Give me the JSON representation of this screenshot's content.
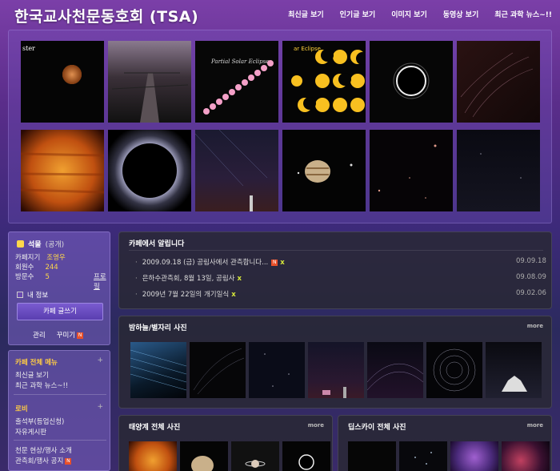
{
  "header": {
    "site_title": "한국교사천문동호회 (TSA)",
    "nav": [
      "최신글 보기",
      "인기글 보기",
      "이미지 보기",
      "동영상 보기",
      "최근 과학 뉴스~!!"
    ]
  },
  "gallery": {
    "thumbs": [
      {
        "icon": "jupiter-photo",
        "caption": "ster"
      },
      {
        "icon": "boardwalk-photo",
        "caption": ""
      },
      {
        "icon": "partial-eclipse-sequence-photo",
        "caption": "Partial Solar Eclipse"
      },
      {
        "icon": "eclipse-phases-grid-photo",
        "caption": "ar Eclipse"
      },
      {
        "icon": "total-eclipse-photo",
        "caption": ""
      },
      {
        "icon": "star-trails-photo",
        "caption": ""
      },
      {
        "icon": "sun-closeup-photo",
        "caption": ""
      },
      {
        "icon": "corona-eclipse-photo",
        "caption": ""
      },
      {
        "icon": "night-sky-tower-photo",
        "caption": ""
      },
      {
        "icon": "jupiter-moons-photo",
        "caption": ""
      },
      {
        "icon": "starfield-photo",
        "caption": ""
      },
      {
        "icon": "dark-sky-photo",
        "caption": ""
      }
    ]
  },
  "profile": {
    "cafe_name": "석물",
    "visibility": "(공개)",
    "manager_label": "카페지기",
    "manager_value": "조영우",
    "members_label": "회원수",
    "members_value": "244",
    "visits_label": "방문수",
    "visits_value": "5",
    "profile_link": "프로필",
    "my_info": "내 정보",
    "write_button": "카페 글쓰기",
    "admin": "관리",
    "decorate": "꾸미기"
  },
  "menu": {
    "head1": "카페 전체 메뉴",
    "items1": [
      "최신글 보기",
      "최근 과학 뉴스~!!"
    ],
    "head2": "로비",
    "items2": [
      "출석부(등업신청)",
      "자유게시판"
    ],
    "items3": [
      "천문 현상/행사 소개",
      "관측회/행사 공지"
    ]
  },
  "notice": {
    "title": "카페에서 알립니다",
    "rows": [
      {
        "text": "2009.09.18 (금) 공림사에서 관측합니다...",
        "date": "09.09.18",
        "new": true
      },
      {
        "text": "은하수관측회, 8월 13일, 공림사",
        "date": "09.08.09",
        "new": false
      },
      {
        "text": "2009년 7월 22일의 개기일식",
        "date": "09.02.06",
        "new": false
      }
    ]
  },
  "night_sky": {
    "title": "밤하늘/별자리 사진",
    "more": "more"
  },
  "solar_system": {
    "title": "태양계 전체 사진",
    "more": "more"
  },
  "deep_sky": {
    "title": "딥스카이 전체 사진",
    "more": "more"
  },
  "colors": {
    "accent_yellow": "#ffd84a",
    "menu_head": "#ffcc44",
    "new_badge": "#e8502a"
  }
}
